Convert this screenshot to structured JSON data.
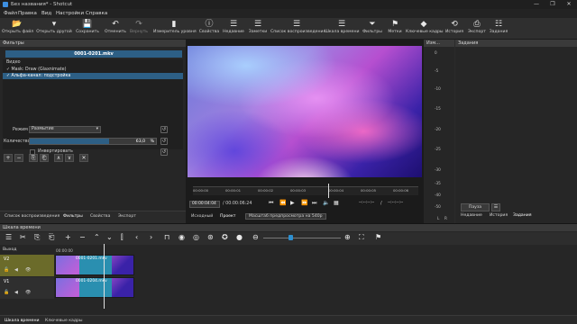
{
  "window": {
    "title": "Без названия* - Shotcut",
    "controls": [
      "—",
      "❐",
      "✕"
    ]
  },
  "menu": [
    "Файл",
    "Правка",
    "Вид",
    "Настройки",
    "Справка"
  ],
  "toolbar": [
    {
      "label": "Открыть файл",
      "icon": "folder-open-icon",
      "glyph": "📂"
    },
    {
      "label": "Открыть другой",
      "icon": "open-other-icon",
      "glyph": "▾"
    },
    {
      "label": "Сохранить",
      "icon": "save-icon",
      "glyph": "💾"
    },
    {
      "label": "Отменить",
      "icon": "undo-icon",
      "glyph": "↶"
    },
    {
      "label": "Вернуть",
      "icon": "redo-icon",
      "glyph": "↷"
    },
    {
      "label": "Измеритель уровня",
      "icon": "audio-meter-icon",
      "glyph": "▮"
    },
    {
      "label": "Свойства",
      "icon": "info-icon",
      "glyph": "ⓘ"
    },
    {
      "label": "Недавние",
      "icon": "recent-icon",
      "glyph": "☰"
    },
    {
      "label": "Заметки",
      "icon": "notes-icon",
      "glyph": "☰"
    },
    {
      "label": "Список воспроизведения",
      "icon": "playlist-icon",
      "glyph": "☰"
    },
    {
      "label": "Шкала времени",
      "icon": "timeline-icon",
      "glyph": "☰"
    },
    {
      "label": "Фильтры",
      "icon": "filter-icon",
      "glyph": "⏷"
    },
    {
      "label": "Метки",
      "icon": "markers-icon",
      "glyph": "⚑"
    },
    {
      "label": "Ключевые кадры",
      "icon": "keyframes-icon",
      "glyph": "◆"
    },
    {
      "label": "История",
      "icon": "history-icon",
      "glyph": "⟲"
    },
    {
      "label": "Экспорт",
      "icon": "export-icon",
      "glyph": "⎙"
    },
    {
      "label": "Задания",
      "icon": "jobs-icon",
      "glyph": "☷"
    }
  ],
  "filters": {
    "title": "Фильтры",
    "file": "0001-0201.mkv",
    "group": "Видео",
    "items": [
      {
        "label": "Mask: Draw (Glaxnimate)",
        "checked": true,
        "selected": false
      },
      {
        "label": "Альфа-канал: подстройка",
        "checked": true,
        "selected": true
      }
    ],
    "buttons": [
      "+",
      "−",
      "⎘",
      "⎗",
      "∧",
      "∨",
      "✕"
    ],
    "mode_label": "Режим",
    "mode_value": "Размытие",
    "amount_label": "Количество",
    "amount_value": "63,0",
    "amount_unit": "%",
    "amount_fraction": 0.63,
    "invert_label": "Инвертировать"
  },
  "left_tabs": [
    "Список воспроизведения",
    "Фильтры",
    "Свойства",
    "Экспорт"
  ],
  "player": {
    "ruler": [
      "00:00:00",
      "00:00:01",
      "00:00:02",
      "00:00:03",
      "00:00:04",
      "00:00:05",
      "00:00:06"
    ],
    "position": "00:00:04:04",
    "duration": "/ 00:00:06:24",
    "in_point": "--:--:--:--",
    "out_point": "--:--:--:--",
    "in_out_sep": "/",
    "tabs": [
      "Исходный",
      "Проект"
    ],
    "scale_button": "Масштаб предпросмотра на 540p"
  },
  "meter": {
    "title": "Изм...",
    "ticks": [
      "0",
      "-5",
      "-10",
      "-15",
      "-20",
      "-25",
      "-30",
      "-35",
      "-40",
      "-50"
    ],
    "channels": [
      "L",
      "R"
    ]
  },
  "jobs": {
    "title": "Задания",
    "pause": "Пауза",
    "menu": "☰"
  },
  "right_tabs": [
    "Недавние",
    "История",
    "Задания"
  ],
  "timeline": {
    "title": "Шкала времени",
    "output": "Выход",
    "time0": "00:00:00",
    "tracks": [
      {
        "name": "V2",
        "clip": "0001-0201.mkv"
      },
      {
        "name": "V1",
        "clip": "0001-0204.mkv"
      }
    ]
  },
  "bottom_tabs": [
    "Шкала времени",
    "Ключевые кадры"
  ],
  "colors": {
    "accent": "#2d5f85",
    "track_v2": "#6b6b2a"
  }
}
